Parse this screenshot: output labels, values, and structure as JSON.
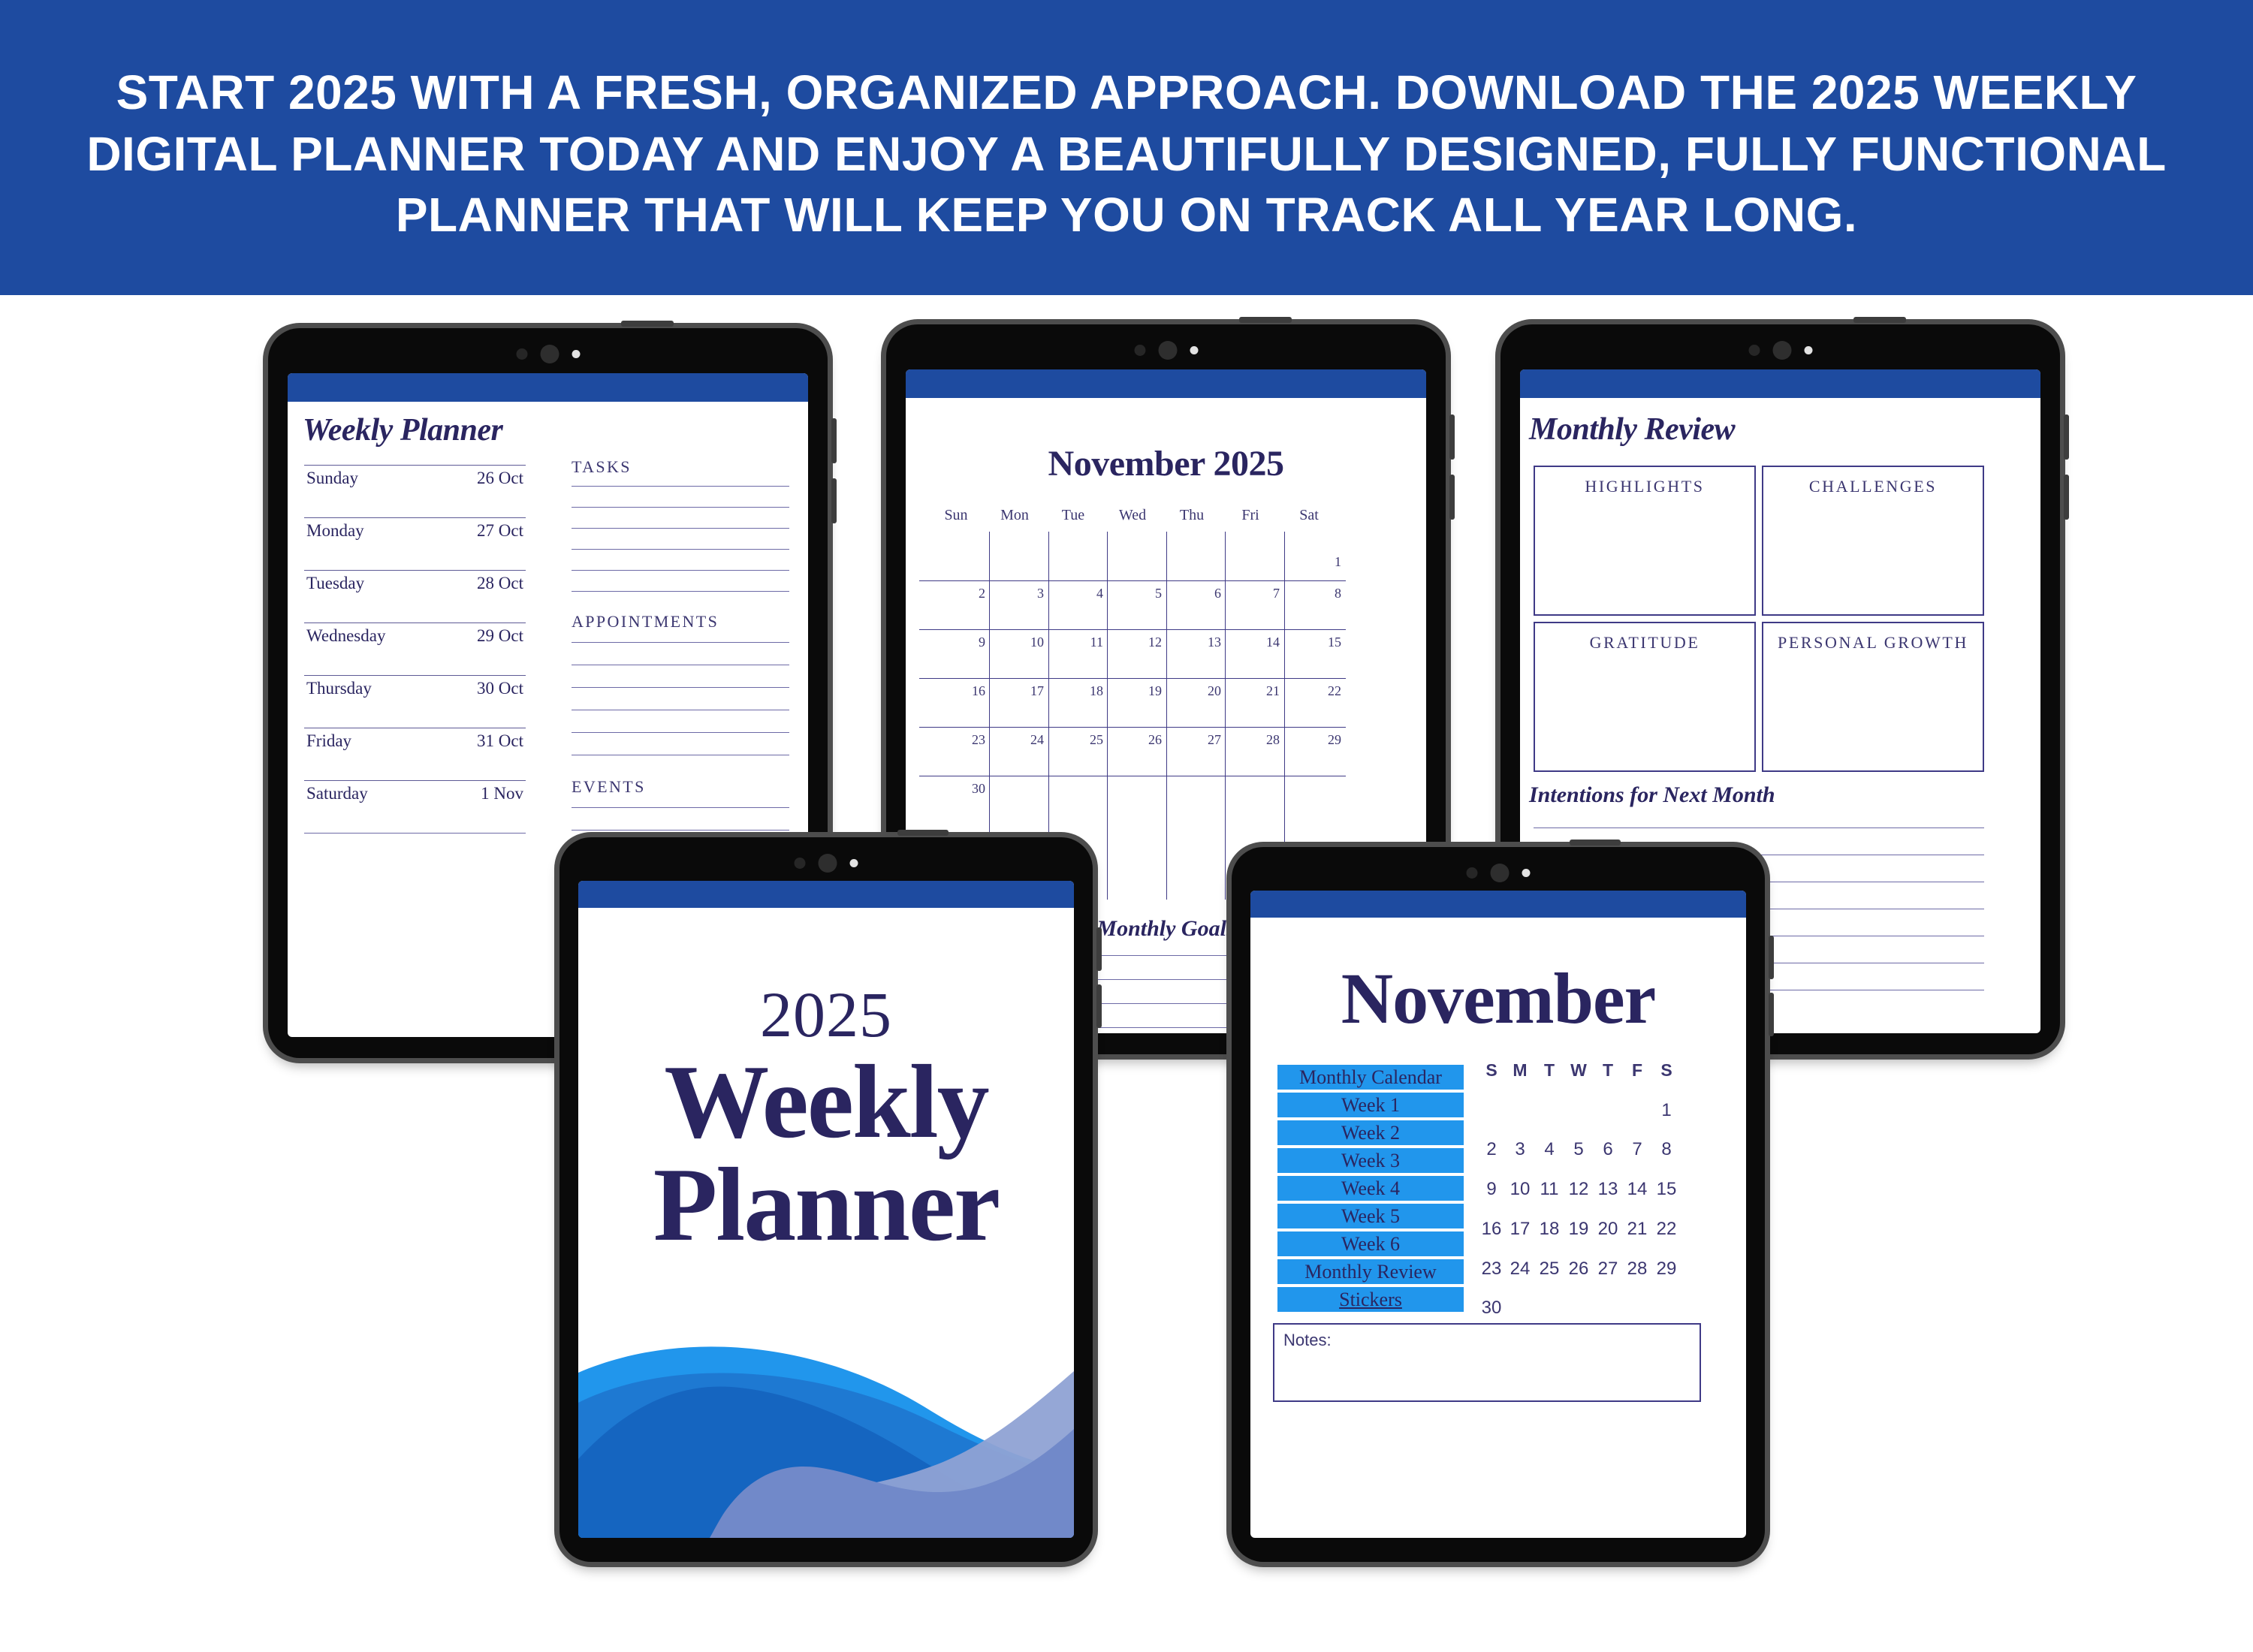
{
  "banner": {
    "headline": "START 2025 WITH A FRESH, ORGANIZED APPROACH. DOWNLOAD THE 2025 WEEKLY DIGITAL PLANNER TODAY AND ENJOY A BEAUTIFULLY DESIGNED, FULLY FUNCTIONAL PLANNER THAT WILL KEEP YOU ON TRACK ALL YEAR LONG.",
    "background_color": "#1E4BA0",
    "text_color": "#FFFFFF"
  },
  "theme": {
    "navy": "#2A2560",
    "banner_blue": "#1E4BA0",
    "button_blue": "#2196EC",
    "rule_blue": "#3F3A86",
    "wave_light": "#2196EC",
    "wave_mid": "#1A6FC9",
    "wave_dark": "#1565C0",
    "wave_periwinkle": "#7189C9"
  },
  "tablets": [
    {
      "id": "weekly-planner",
      "page_title": "Weekly Planner",
      "days": [
        {
          "name": "Sunday",
          "date": "26 Oct"
        },
        {
          "name": "Monday",
          "date": "27 Oct"
        },
        {
          "name": "Tuesday",
          "date": "28 Oct"
        },
        {
          "name": "Wednesday",
          "date": "29 Oct"
        },
        {
          "name": "Thursday",
          "date": "30 Oct"
        },
        {
          "name": "Friday",
          "date": "31 Oct"
        },
        {
          "name": "Saturday",
          "date": "1 Nov"
        }
      ],
      "sections": [
        {
          "label": "TASKS",
          "lines": 6
        },
        {
          "label": "APPOINTMENTS",
          "lines": 6
        },
        {
          "label": "EVENTS",
          "lines": 6
        }
      ]
    },
    {
      "id": "november-calendar",
      "title": "November 2025",
      "dow": [
        "Sun",
        "Mon",
        "Tue",
        "Wed",
        "Thu",
        "Fri",
        "Sat"
      ],
      "weeks": [
        [
          "",
          "",
          "",
          "",
          "",
          "",
          "1"
        ],
        [
          "2",
          "3",
          "4",
          "5",
          "6",
          "7",
          "8"
        ],
        [
          "9",
          "10",
          "11",
          "12",
          "13",
          "14",
          "15"
        ],
        [
          "16",
          "17",
          "18",
          "19",
          "20",
          "21",
          "22"
        ],
        [
          "23",
          "24",
          "25",
          "26",
          "27",
          "28",
          "29"
        ],
        [
          "30",
          "",
          "",
          "",
          "",
          "",
          ""
        ]
      ],
      "goals_title": "Monthly Goals",
      "goals_lines": 4
    },
    {
      "id": "monthly-review",
      "page_title": "Monthly Review",
      "boxes": [
        "HIGHLIGHTS",
        "CHALLENGES",
        "GRATITUDE",
        "PERSONAL GROWTH"
      ],
      "subtitle": "Intentions for Next Month",
      "intention_lines": 7
    },
    {
      "id": "cover",
      "year": "2025",
      "title_line1": "Weekly",
      "title_line2": "Planner"
    },
    {
      "id": "november-nav",
      "title": "November",
      "nav_buttons": [
        {
          "label": "Monthly Calendar",
          "underline": false
        },
        {
          "label": "Week 1",
          "underline": false
        },
        {
          "label": "Week 2",
          "underline": false
        },
        {
          "label": "Week 3",
          "underline": false
        },
        {
          "label": "Week 4",
          "underline": false
        },
        {
          "label": "Week 5",
          "underline": false
        },
        {
          "label": "Week 6",
          "underline": false
        },
        {
          "label": "Monthly Review",
          "underline": false
        },
        {
          "label": "Stickers",
          "underline": true
        }
      ],
      "dow": [
        "S",
        "M",
        "T",
        "W",
        "T",
        "F",
        "S"
      ],
      "weeks": [
        [
          "",
          "",
          "",
          "",
          "",
          "",
          "1"
        ],
        [
          "2",
          "3",
          "4",
          "5",
          "6",
          "7",
          "8"
        ],
        [
          "9",
          "10",
          "11",
          "12",
          "13",
          "14",
          "15"
        ],
        [
          "16",
          "17",
          "18",
          "19",
          "20",
          "21",
          "22"
        ],
        [
          "23",
          "24",
          "25",
          "26",
          "27",
          "28",
          "29"
        ],
        [
          "30",
          "",
          "",
          "",
          "",
          "",
          ""
        ]
      ],
      "notes_label": "Notes:"
    }
  ]
}
